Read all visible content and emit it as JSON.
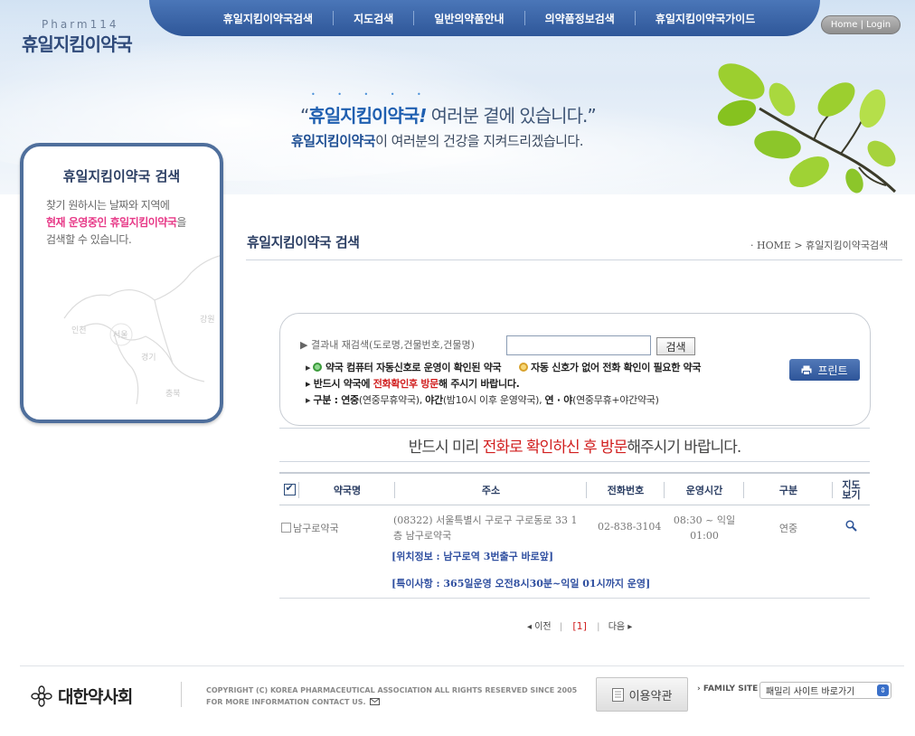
{
  "brand": {
    "logo_en": "Pharm114",
    "logo_ko": "휴일지킴이약국"
  },
  "nav": {
    "items": [
      "휴일지킴이약국검색",
      "지도검색",
      "일반의약품안내",
      "의약품정보검색",
      "휴일지킴이약국가이드"
    ],
    "home_login": "Home | Login"
  },
  "hero": {
    "dots": "• • • • •",
    "slogan_q_open": "“",
    "slogan_bold": "휴일지킴이약국",
    "slogan_mark": "!",
    "slogan_rest": " 여러분 곁에 있습니다.”",
    "slogan2_bold": "휴일지킴이약국",
    "slogan2_rest": "이 여러분의 건강을 지켜드리겠습니다."
  },
  "sidebar": {
    "title": "휴일지킴이약국 검색",
    "desc1": "찾기 원하시는 날짜와 지역에",
    "desc2_pink": "현재 운영중인 휴일지킴이약국",
    "desc2_rest": "을",
    "desc3": "검색할 수 있습니다.",
    "map_labels": [
      "인천",
      "서울",
      "경기",
      "강원",
      "충북"
    ]
  },
  "page": {
    "title": "휴일지킴이약국 검색",
    "breadcrumb": "· HOME > 휴일지킴이약국검색"
  },
  "search": {
    "label": "▶ 결과내 재검색(도로명,건물번호,건물명)",
    "input_value": "",
    "button": "검색",
    "line1_prefix": "▸ ",
    "line1_a": " 약국 컴퓨터 자동신호로 운영이 확인된 약국",
    "line1_b": " 자동 신호가 없어 전화 확인이 필요한 약국",
    "line2_a": "▸ 반드시 약국에 ",
    "line2_red": "전화확인후 방문",
    "line2_b": "해 주시기 바랍니다.",
    "line3_a": "▸ ",
    "line3_b1": "구분 : 연중",
    "line3_t1": "(연중무휴약국), ",
    "line3_b2": "야간",
    "line3_t2": "(밤10시 이후 운영약국), ",
    "line3_b3": "연 · 야",
    "line3_t3": "(연중무휴+야간약국)",
    "print": "프린트"
  },
  "notice": {
    "a": "반드시 미리 ",
    "red": "전화로 확인하신 후 방문",
    "b": "해주시기 바랍니다."
  },
  "table": {
    "headers": {
      "name": "약국명",
      "address": "주소",
      "phone": "전화번호",
      "hours": "운영시간",
      "type": "구분",
      "map1": "지도",
      "map2": "보기"
    },
    "rows": [
      {
        "name": "남구로약국",
        "address1": "(08322) 서울특별시 구로구 구로동로 33 1",
        "address2": "층 남구로약국",
        "phone": "02-838-3104",
        "hours1": "08:30 ~ 익일",
        "hours2": "01:00",
        "type": "연중",
        "location": "[위치정보 : 남구로역 3번출구 바로앞]",
        "special": "[특이사항 : 365일운영 오전8시30분~익일 01시까지 운영]"
      }
    ]
  },
  "pager": {
    "prev": "◂ 이전",
    "current": "[1]",
    "next": "다음 ▸",
    "sep": "|"
  },
  "footer": {
    "logo": "대한약사회",
    "copyright1": "COPYRIGHT (C) KOREA PHARMACEUTICAL ASSOCIATION ALL RIGHTS RESERVED SINCE 2005",
    "copyright2": "FOR MORE INFORMATION CONTACT US.",
    "terms": "이용약관",
    "family_label": "› FAMILY SITE",
    "family_select": "패밀리 사이트 바로가기"
  },
  "colors": {
    "brand_blue": "#2f5799",
    "accent_red": "#d11f1f",
    "pink": "#e73a88",
    "title_navy": "#2b3e63"
  }
}
